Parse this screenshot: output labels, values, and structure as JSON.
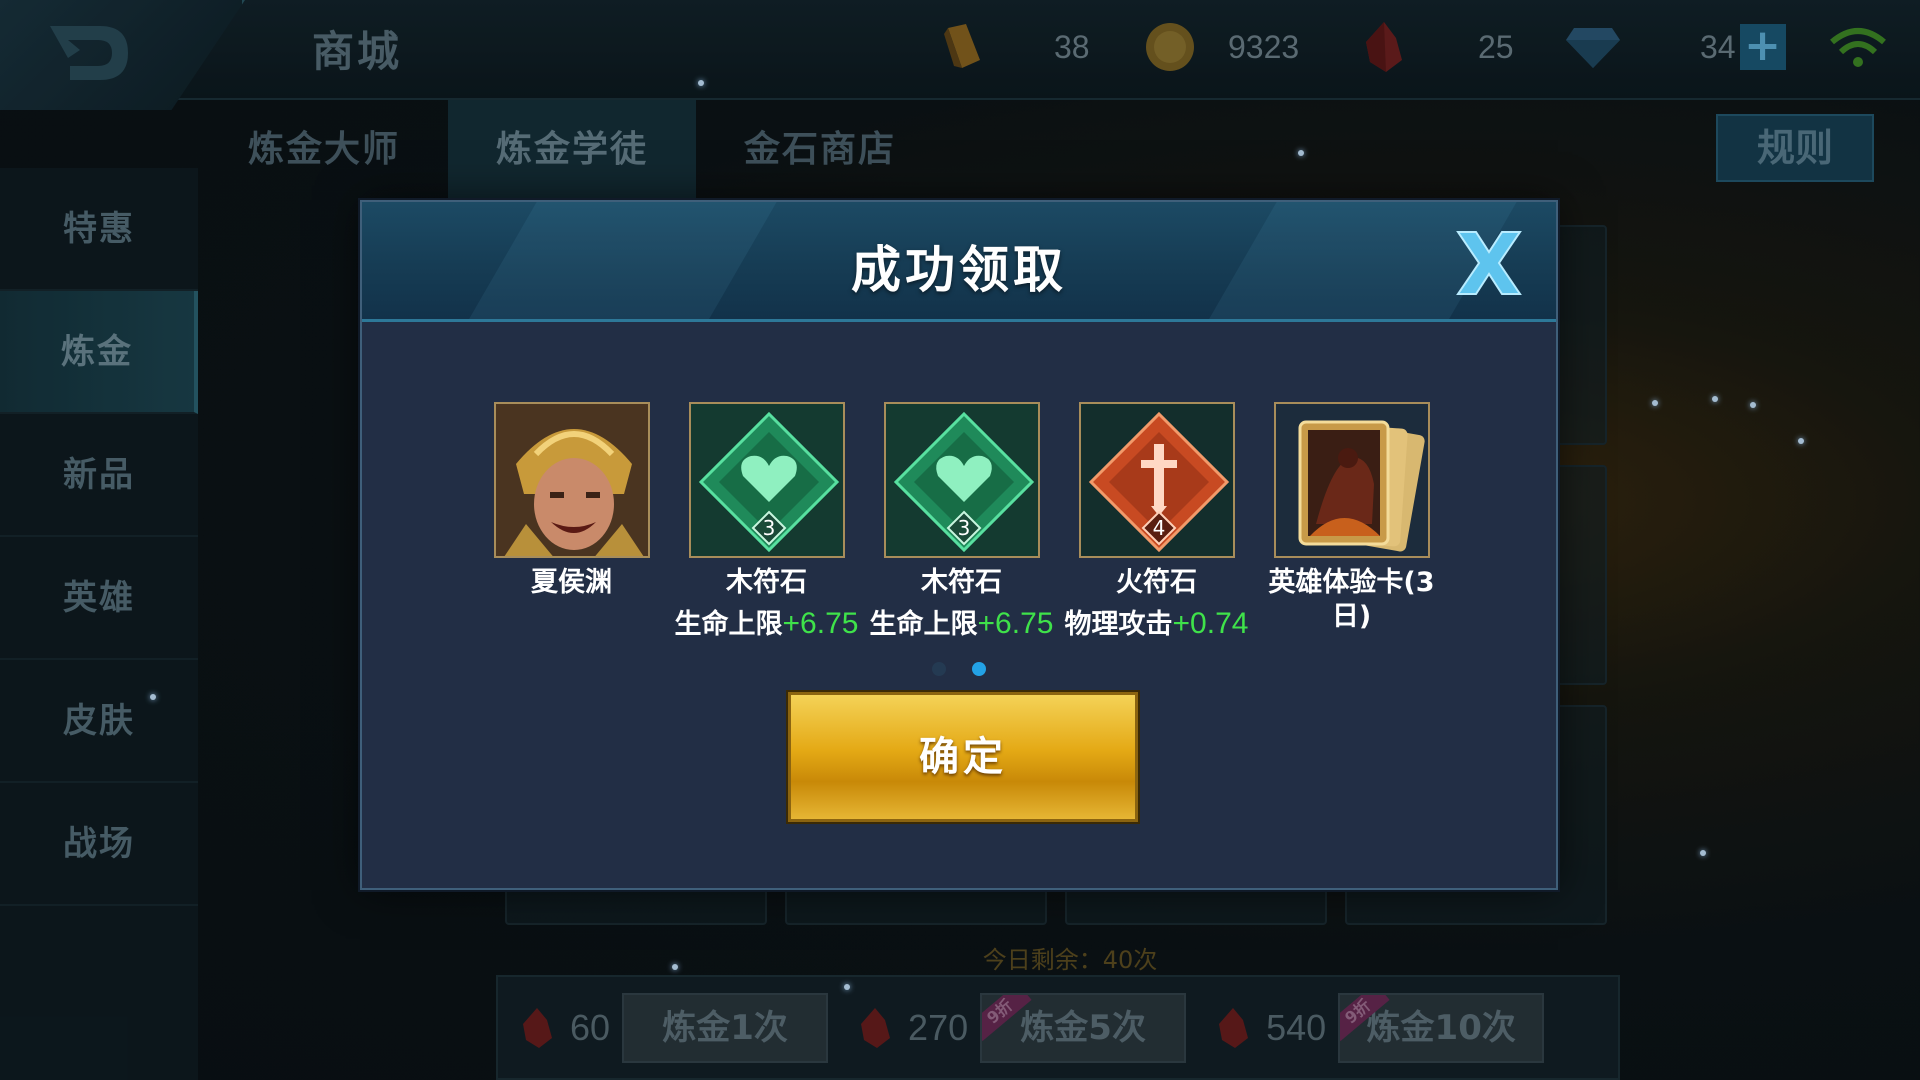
{
  "header": {
    "title": "商城",
    "currencies": [
      {
        "icon": "gold-ingot-icon",
        "value": "38"
      },
      {
        "icon": "coin-icon",
        "value": "9323"
      },
      {
        "icon": "red-crystal-icon",
        "value": "25"
      },
      {
        "icon": "diamond-icon",
        "value": "34"
      }
    ],
    "add_symbol": "+"
  },
  "tabs": [
    {
      "label": "炼金大师"
    },
    {
      "label": "炼金学徒"
    },
    {
      "label": "金石商店"
    }
  ],
  "rules_label": "规则",
  "sidebar": [
    {
      "label": "特惠"
    },
    {
      "label": "炼金"
    },
    {
      "label": "新品"
    },
    {
      "label": "英雄"
    },
    {
      "label": "皮肤"
    },
    {
      "label": "战场"
    }
  ],
  "remaining_text": "今日剩余：40次",
  "purchase": [
    {
      "cost": "60",
      "label": "炼金1次",
      "discount": ""
    },
    {
      "cost": "270",
      "label": "炼金5次",
      "discount": "9折"
    },
    {
      "cost": "540",
      "label": "炼金10次",
      "discount": "9折"
    }
  ],
  "modal": {
    "title": "成功领取",
    "confirm_label": "确定",
    "rewards": [
      {
        "name": "夏侯渊",
        "icon": "hero-portrait-icon",
        "stat_label": "",
        "stat_value": ""
      },
      {
        "name": "木符石",
        "icon": "wood-rune-icon",
        "level": "3",
        "stat_label": "生命上限",
        "stat_value": "+6.75"
      },
      {
        "name": "木符石",
        "icon": "wood-rune-icon",
        "level": "3",
        "stat_label": "生命上限",
        "stat_value": "+6.75"
      },
      {
        "name": "火符石",
        "icon": "fire-rune-icon",
        "level": "4",
        "stat_label": "物理攻击",
        "stat_value": "+0.74"
      },
      {
        "name": "英雄体验卡(3日)",
        "icon": "hero-trial-card-icon",
        "stat_label": "",
        "stat_value": ""
      }
    ],
    "pager": {
      "total": 2,
      "active": 2
    }
  },
  "colors": {
    "stat_positive": "#3fe24a",
    "confirm_gold": "#e4a915",
    "pager_active": "#23a2e6"
  }
}
